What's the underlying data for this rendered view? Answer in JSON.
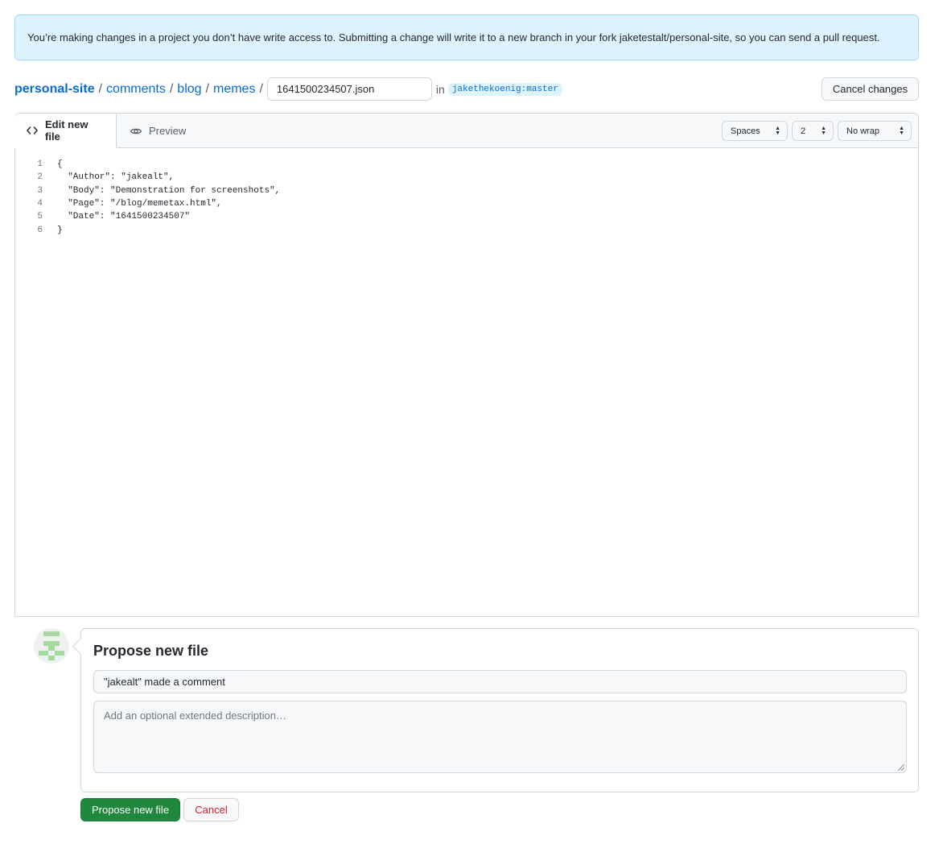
{
  "flash": {
    "message": "You’re making changes in a project you don’t have write access to. Submitting a change will write it to a new branch in your fork jaketestalt/personal-site, so you can send a pull request."
  },
  "breadcrumb": {
    "repo": "personal-site",
    "path": [
      "comments",
      "blog",
      "memes"
    ],
    "separator": "/",
    "filename": "1641500234507.json",
    "in_label": "in",
    "branch": "jakethekoenig:master"
  },
  "header": {
    "cancel_changes_label": "Cancel changes"
  },
  "editor": {
    "tab_edit_label": "Edit new file",
    "tab_preview_label": "Preview",
    "indent_mode": "Spaces",
    "indent_size": "2",
    "wrap_mode": "No wrap",
    "lines": [
      {
        "num": "1",
        "text": "{"
      },
      {
        "num": "2",
        "text": "  \"Author\": \"jakealt\","
      },
      {
        "num": "3",
        "text": "  \"Body\": \"Demonstration for screenshots\","
      },
      {
        "num": "4",
        "text": "  \"Page\": \"/blog/memetax.html\","
      },
      {
        "num": "5",
        "text": "  \"Date\": \"1641500234507\""
      },
      {
        "num": "6",
        "text": "}"
      }
    ]
  },
  "commit": {
    "title": "Propose new file",
    "summary_value": "\"jakealt\" made a comment",
    "description_placeholder": "Add an optional extended description…",
    "propose_label": "Propose new file",
    "cancel_label": "Cancel"
  },
  "colors": {
    "link": "#0969da",
    "primary_button": "#1f883d",
    "danger_text": "#cf222e",
    "flash_bg": "#ddf4ff"
  }
}
